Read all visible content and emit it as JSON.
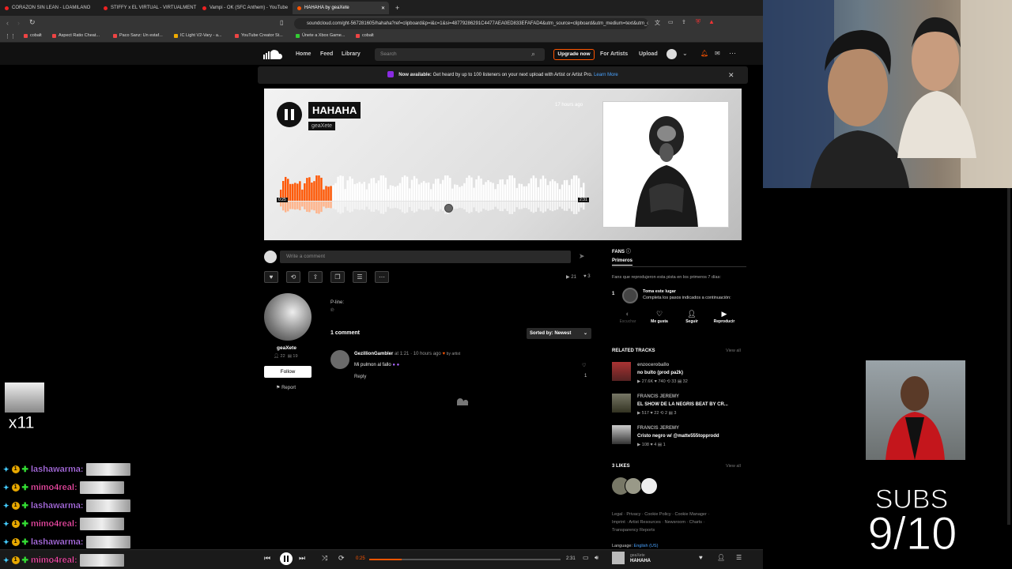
{
  "browser": {
    "tabs": [
      {
        "label": "CORAZON SIN LEAN - LOAMILANO",
        "active": false
      },
      {
        "label": "STIFFY x EL VIRTUAL - VIRTUALMENT",
        "active": false
      },
      {
        "label": "Vampi - OK (SFC Anthem) - YouTube",
        "active": false
      },
      {
        "label": "HAHAHA by geaXete",
        "active": true
      }
    ],
    "url": "soundcloud.com/ght-567281605/hahaha?ref=clipboard&p=i&c=1&si=48779286291C4477AEA0ED833EFAFAD4&utm_source=clipboard&utm_medium=text&utm_campaign=social_sharing",
    "bookmarks": [
      "cobalt",
      "Aspect Ratio Cheat...",
      "Paco Sanz: Un estaf...",
      "IC Light V2-Vary - a...",
      "YouTube Creator St...",
      "Únete a Xbox Game...",
      "cobalt"
    ]
  },
  "header": {
    "nav": [
      "Home",
      "Feed",
      "Library"
    ],
    "search_placeholder": "Search",
    "upgrade": "Upgrade now",
    "for_artists": "For Artists",
    "upload": "Upload"
  },
  "banner": {
    "bold": "Now available:",
    "text": "Get heard by up to 100 listeners on your next upload with Artist or Artist Pro.",
    "link": "Learn More"
  },
  "track": {
    "title": "HAHAHA",
    "artist": "geaXete",
    "posted": "17 hours ago",
    "elapsed": "0:25",
    "duration": "2:31"
  },
  "comment": {
    "placeholder": "Write a comment",
    "plays": "21",
    "likes": "3"
  },
  "uploader": {
    "name": "geaXete",
    "followers": "22",
    "tracks": "19",
    "follow": "Follow",
    "report": "Report",
    "pline": "P-line:",
    "pline_val": "℗"
  },
  "comments": {
    "count": "1 comment",
    "sort": "Sorted by: Newest",
    "items": [
      {
        "user": "GezillionGambler",
        "at": "at 1:21",
        "time": "· 10 hours ago",
        "by": "by artist",
        "text": "Mi pulmon al fallo",
        "reply": "Reply",
        "likes": "1"
      }
    ]
  },
  "fans": {
    "title": "FANS",
    "tab": "Primeros",
    "desc": "Fans que reprodujeron esta pista en los primeros 7 días:",
    "rank": "1",
    "slot_title": "Toma este lugar",
    "slot_desc": "Completa los pasos indicados a continuación:",
    "steps": [
      "Escuchar",
      "Me gusta",
      "Seguir",
      "Reproducir"
    ]
  },
  "related": {
    "title": "RELATED TRACKS",
    "view": "View all",
    "items": [
      {
        "artist": "enzoceroballo",
        "title": "no bulto (prod pa2k)",
        "stats": "▶ 27.6K  ♥ 740  ⟲ 33  ▤ 32"
      },
      {
        "artist": "FRANCIS JEREMY",
        "title": "EL SHOW DE LA NEGRIS BEAT BY CR...",
        "stats": "▶ 517  ♥ 22  ⟲ 2  ▤ 3"
      },
      {
        "artist": "FRANCIS JEREMY",
        "title": "Cristo negro w/ @matte555topprodd",
        "stats": "▶ 108  ♥ 4  ▤ 1"
      }
    ]
  },
  "likes": {
    "title": "3 LIKES",
    "view": "View all"
  },
  "footer": {
    "line1": "Legal · Privacy · Cookie Policy · Cookie Manager ·",
    "line2": "Imprint · Artist Resources · Newsroom · Charts ·",
    "line3": "Transparency Reports",
    "lang_label": "Language:",
    "lang": "English (US)"
  },
  "player": {
    "elapsed": "0:25",
    "duration": "2:31",
    "artist": "geaXete",
    "title": "HAHAHA",
    "progress": 0.17
  },
  "stream": {
    "sticker_count": "x11",
    "chat": [
      {
        "user": "lashawarma",
        "sep": ":",
        "color": "#c07bff"
      },
      {
        "user": "mimo4real",
        "sep": ":",
        "color": "#ff4fb0"
      },
      {
        "user": "lashawarma",
        "sep": ":",
        "color": "#c07bff"
      },
      {
        "user": "mimo4real",
        "sep": ":",
        "color": "#ff4fb0"
      },
      {
        "user": "lashawarma",
        "sep": ":",
        "color": "#c07bff"
      },
      {
        "user": "mimo4real",
        "sep": ":",
        "color": "#ff4fb0"
      }
    ],
    "subs_label": "SUBS",
    "subs_count": "9/10"
  },
  "colors": {
    "accent": "#ff5500",
    "bg": "#121212"
  }
}
